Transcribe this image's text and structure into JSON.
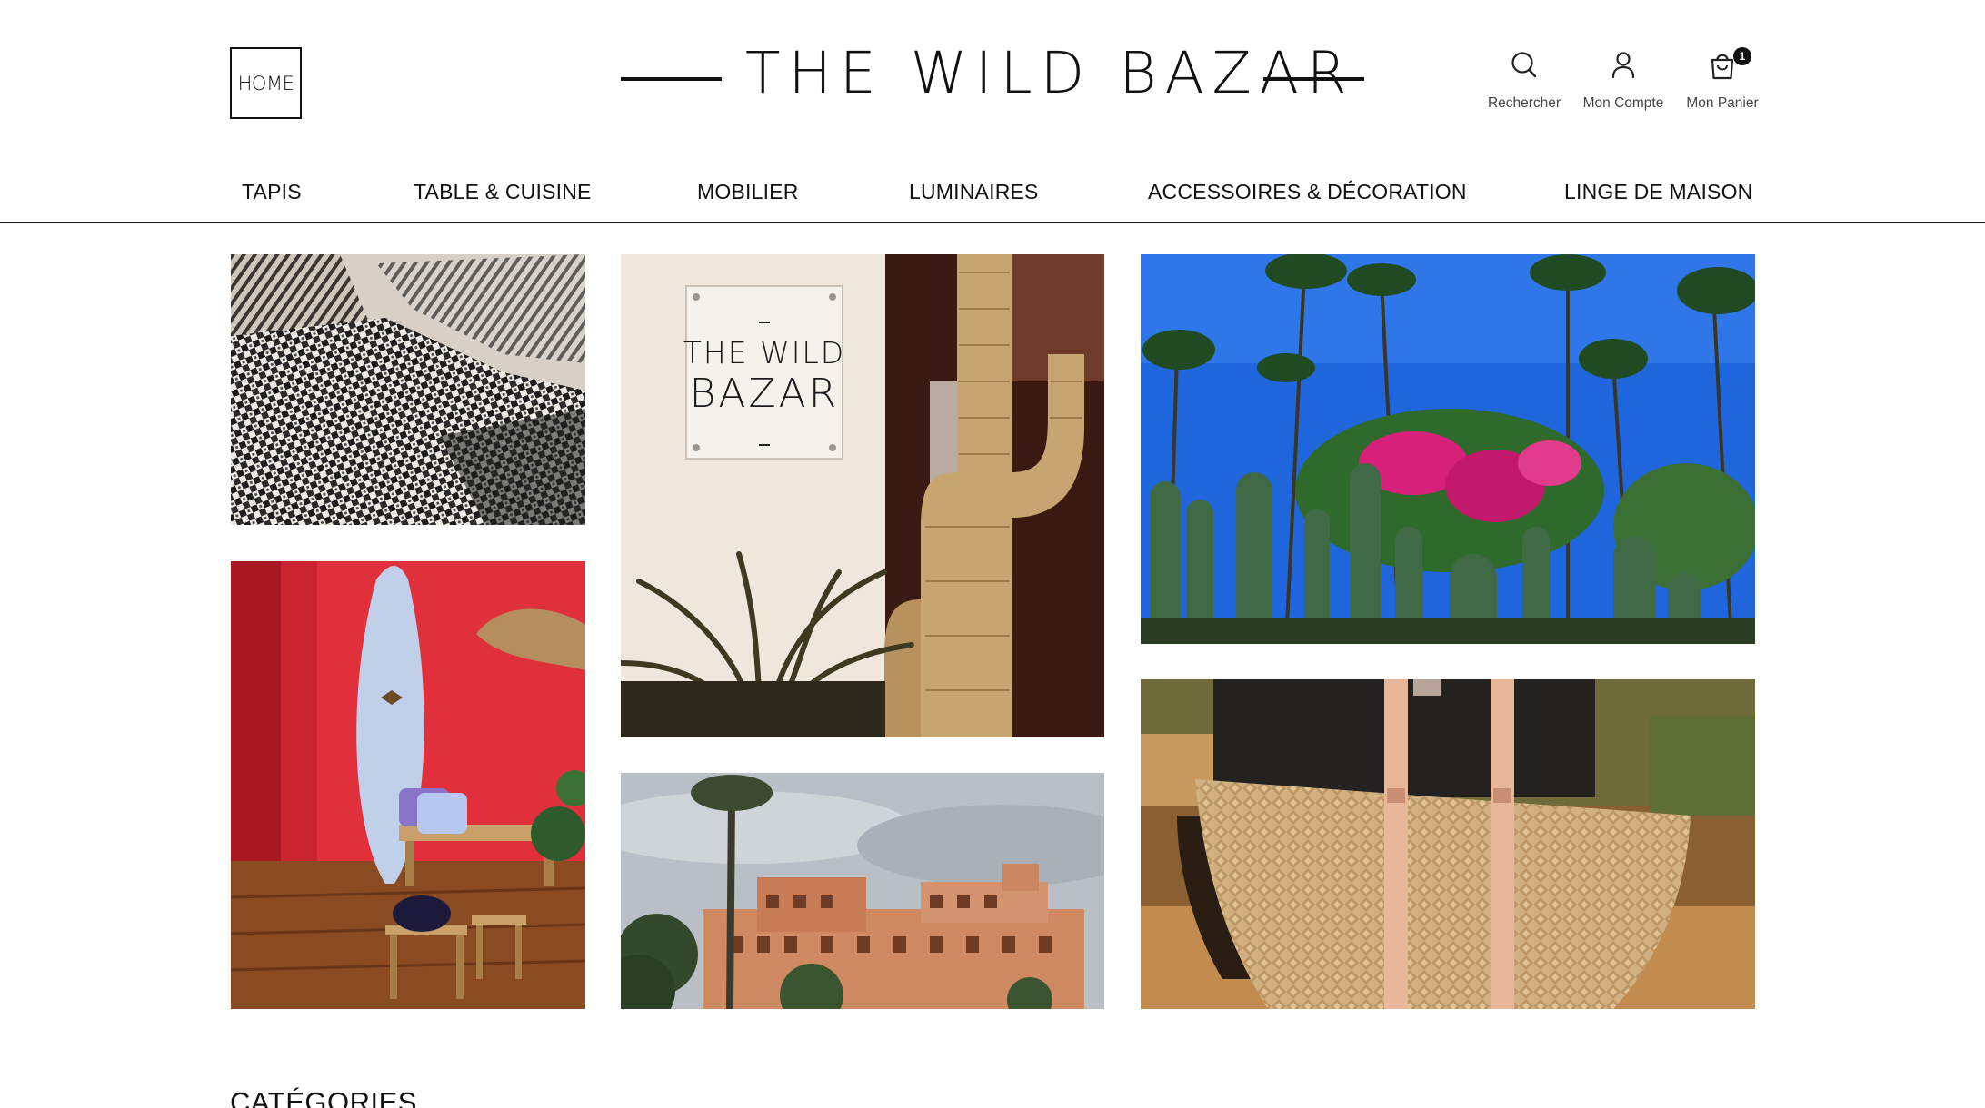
{
  "header": {
    "home_logo": "HOME",
    "brand_title": "THE WILD BAZAR",
    "actions": {
      "search_label": "Rechercher",
      "account_label": "Mon Compte",
      "cart_label": "Mon Panier",
      "cart_count": "1"
    }
  },
  "nav": {
    "items": [
      "TAPIS",
      "TABLE & CUISINE",
      "MOBILIER",
      "LUMINAIRES",
      "ACCESSOIRES & DÉCORATION",
      "LINGE DE MAISON"
    ]
  },
  "gallery": {
    "sign_line1": "THE WILD",
    "sign_line2": "BAZAR"
  },
  "sections": {
    "categories_heading": "CATÉGORIES"
  },
  "colors": {
    "text": "#111111",
    "background": "#ffffff",
    "wall_red": "#e0303c",
    "sky_blue": "#1a6ee8"
  }
}
